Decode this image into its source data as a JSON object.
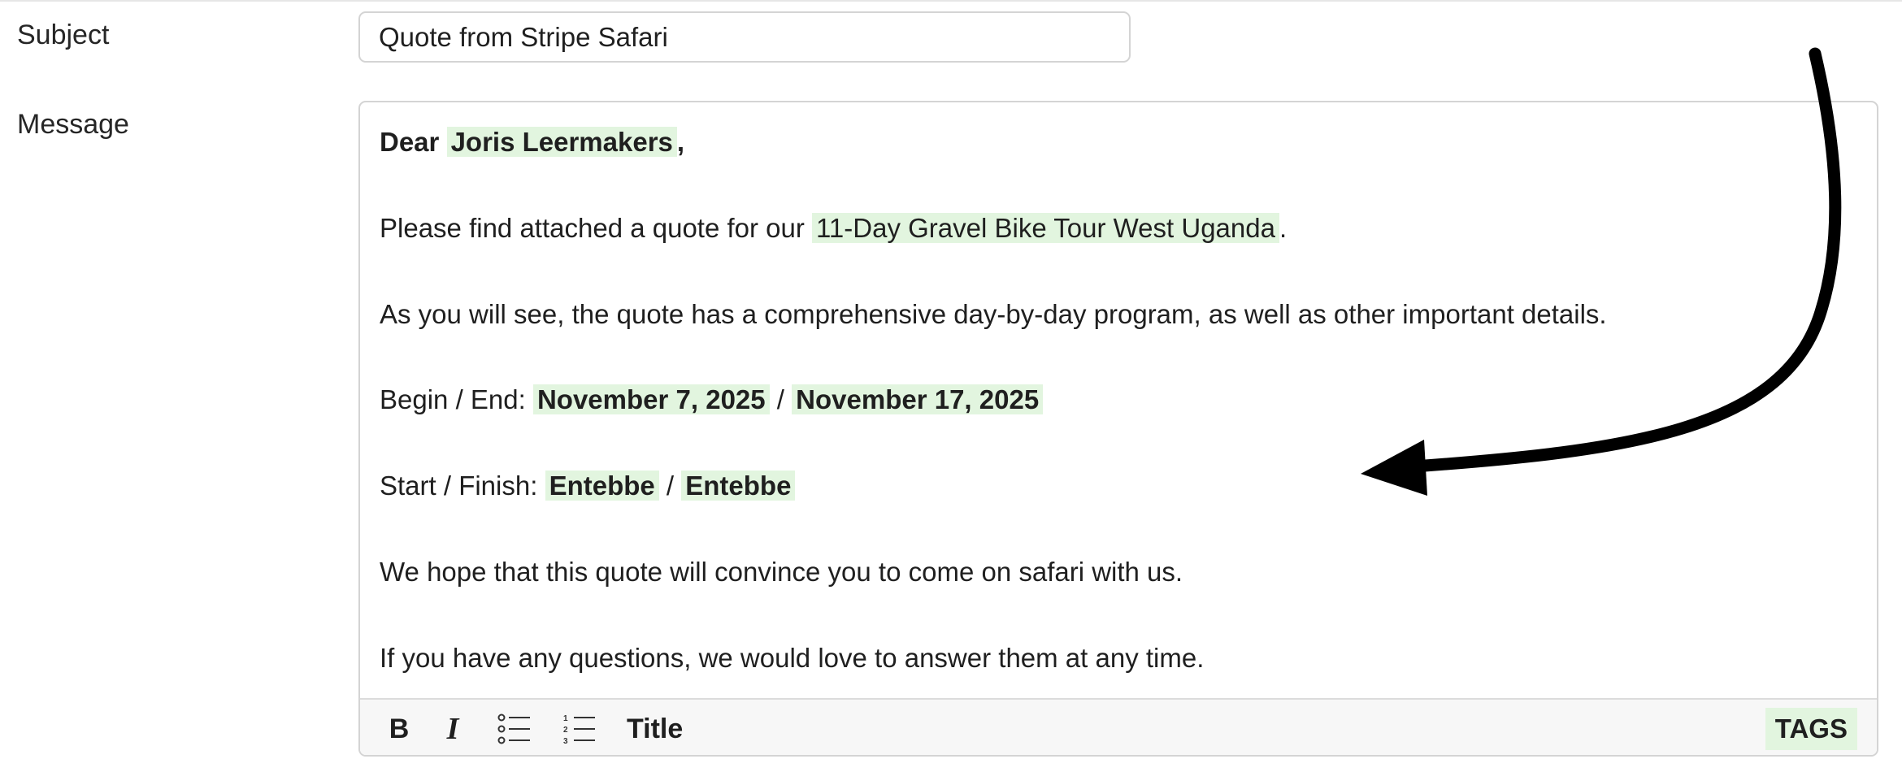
{
  "subject": {
    "label": "Subject",
    "value": "Quote from Stripe Safari"
  },
  "message": {
    "label": "Message",
    "greeting": {
      "prefix": "Dear ",
      "name": "Joris Leermakers",
      "suffix": ","
    },
    "line_quote": {
      "prefix": "Please find attached a quote for our ",
      "tour": "11-Day Gravel Bike Tour West Uganda",
      "suffix": "."
    },
    "line_program": "As you will see, the quote has a comprehensive day-by-day program, as well as other important details.",
    "line_dates": {
      "prefix": "Begin / End: ",
      "begin": "November 7, 2025",
      "separator": " / ",
      "end": "November 17, 2025"
    },
    "line_places": {
      "prefix": "Start / Finish: ",
      "start": "Entebbe",
      "separator": " / ",
      "finish": "Entebbe"
    },
    "line_hope": "We hope that this quote will convince you to come on safari with us.",
    "line_questions": "If you have any questions, we would love to answer them at any time."
  },
  "toolbar": {
    "bold": "B",
    "italic": "I",
    "bullet_list_icon": "bullet-list-icon",
    "numbered_list_icon": "numbered-list-icon",
    "title": "Title",
    "tags": "TAGS"
  },
  "colors": {
    "tag_highlight": "#e2f5df",
    "border": "#d4d4d4",
    "toolbar_bg": "#f7f7f7",
    "arrow": "#000000"
  }
}
